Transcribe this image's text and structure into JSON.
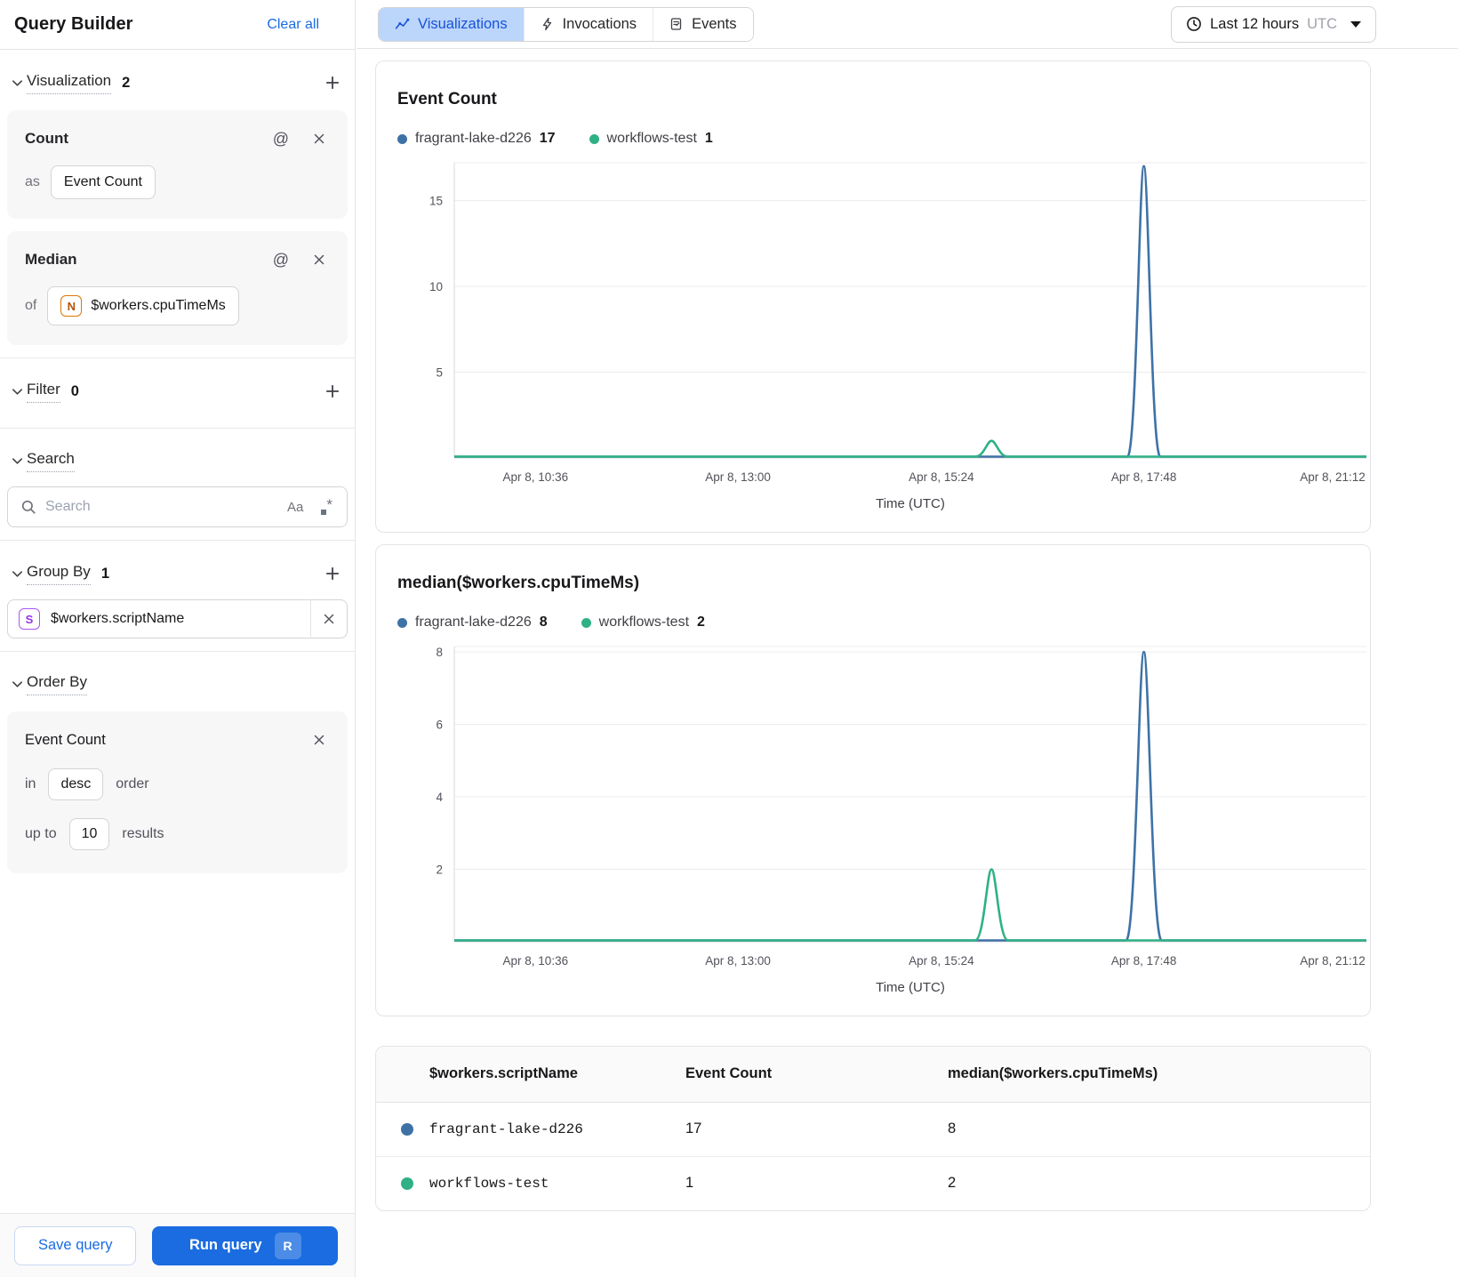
{
  "sidebar": {
    "title": "Query Builder",
    "clear_all": "Clear all",
    "sections": {
      "visualization": {
        "label": "Visualization",
        "count": "2"
      },
      "filter": {
        "label": "Filter",
        "count": "0"
      },
      "search": {
        "label": "Search"
      },
      "group_by": {
        "label": "Group By",
        "count": "1"
      },
      "order_by": {
        "label": "Order By"
      }
    },
    "visualizations": [
      {
        "name": "Count",
        "prefix": "as",
        "value": "Event Count"
      },
      {
        "name": "Median",
        "prefix": "of",
        "badge": "N",
        "value": "$workers.cpuTimeMs"
      }
    ],
    "search_placeholder": "Search",
    "group_by_items": [
      {
        "badge": "S",
        "value": "$workers.scriptName"
      }
    ],
    "order_by": {
      "field": "Event Count",
      "in_label": "in",
      "direction": "desc",
      "order_label": "order",
      "up_to_label": "up to",
      "limit": "10",
      "results_label": "results"
    },
    "footer": {
      "save": "Save query",
      "run": "Run query",
      "run_shortcut": "R"
    }
  },
  "topbar": {
    "tabs": [
      {
        "label": "Visualizations",
        "icon": "chart-line-icon",
        "active": true
      },
      {
        "label": "Invocations",
        "icon": "lightning-icon",
        "active": false
      },
      {
        "label": "Events",
        "icon": "events-icon",
        "active": false
      }
    ],
    "time_range": {
      "label": "Last 12 hours",
      "zone": "UTC"
    }
  },
  "icons": {
    "at": "@",
    "match_case": "Aa",
    "regex_star": "*"
  },
  "colors": {
    "blue_series": "#3e72a6",
    "green_series": "#2fb185",
    "accent_blue": "#1a6ce0",
    "active_tab_bg": "#bcd5fb"
  },
  "chart_data": [
    {
      "type": "line",
      "title": "Event Count",
      "xlabel": "Time (UTC)",
      "ylabel": "",
      "x_ticks": [
        "Apr 8, 10:36",
        "Apr 8, 13:00",
        "Apr 8, 15:24",
        "Apr 8, 17:48",
        "Apr 8, 21:12"
      ],
      "x_tick_fracs": [
        0.089,
        0.311,
        0.534,
        0.756,
        0.963
      ],
      "y_ticks": [
        5,
        10,
        15
      ],
      "ylim": [
        0,
        17.2
      ],
      "grid": true,
      "legend_position": "top",
      "legend": [
        {
          "name": "fragrant-lake-d226",
          "total": 17,
          "color": "#3e72a6"
        },
        {
          "name": "workflows-test",
          "total": 1,
          "color": "#2fb185"
        }
      ],
      "series": [
        {
          "name": "fragrant-lake-d226",
          "color": "#3e72a6",
          "baseline": 0,
          "spikes": [
            {
              "x_frac": 0.756,
              "peak": 17,
              "half_width_frac": 0.018
            }
          ]
        },
        {
          "name": "workflows-test",
          "color": "#2fb185",
          "baseline": 0,
          "spikes": [
            {
              "x_frac": 0.589,
              "peak": 1,
              "half_width_frac": 0.018
            }
          ]
        }
      ]
    },
    {
      "type": "line",
      "title": "median($workers.cpuTimeMs)",
      "xlabel": "Time (UTC)",
      "ylabel": "",
      "x_ticks": [
        "Apr 8, 10:36",
        "Apr 8, 13:00",
        "Apr 8, 15:24",
        "Apr 8, 17:48",
        "Apr 8, 21:12"
      ],
      "x_tick_fracs": [
        0.089,
        0.311,
        0.534,
        0.756,
        0.963
      ],
      "y_ticks": [
        2,
        4,
        6,
        8
      ],
      "ylim": [
        0,
        8.15
      ],
      "grid": true,
      "legend_position": "top",
      "legend": [
        {
          "name": "fragrant-lake-d226",
          "total": 8,
          "color": "#3e72a6"
        },
        {
          "name": "workflows-test",
          "total": 2,
          "color": "#2fb185"
        }
      ],
      "series": [
        {
          "name": "fragrant-lake-d226",
          "color": "#3e72a6",
          "baseline": 0,
          "spikes": [
            {
              "x_frac": 0.756,
              "peak": 8,
              "half_width_frac": 0.0195
            }
          ]
        },
        {
          "name": "workflows-test",
          "color": "#2fb185",
          "baseline": 0,
          "spikes": [
            {
              "x_frac": 0.589,
              "peak": 2,
              "half_width_frac": 0.018
            }
          ]
        }
      ]
    },
    {
      "type": "table",
      "columns": [
        "$workers.scriptName",
        "Event Count",
        "median($workers.cpuTimeMs)"
      ],
      "rows": [
        {
          "dot_color": "#3e72a6",
          "cells": [
            "fragrant-lake-d226",
            "17",
            "8"
          ]
        },
        {
          "dot_color": "#2fb185",
          "cells": [
            "workflows-test",
            "1",
            "2"
          ]
        }
      ]
    }
  ]
}
